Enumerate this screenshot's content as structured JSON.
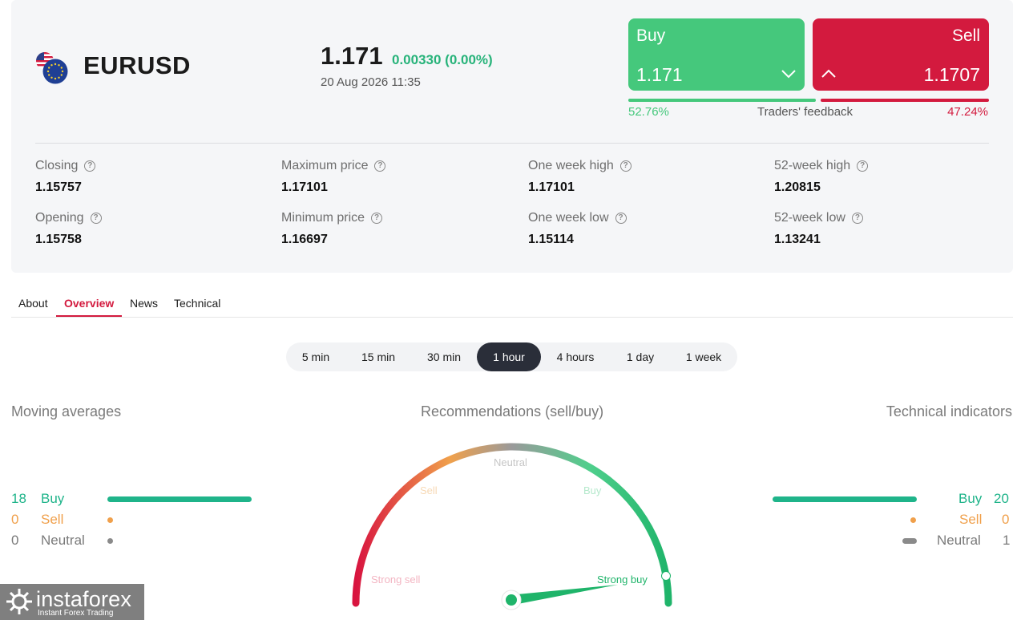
{
  "instrument": {
    "symbol": "EURUSD",
    "price": "1.171",
    "change": "0.00330 (0.00%)",
    "datetime": "20 Aug 2026 11:35",
    "flag_icons": [
      "us-flag-icon",
      "eu-flag-icon"
    ]
  },
  "trade": {
    "buy_label": "Buy",
    "buy_price": "1.171",
    "sell_label": "Sell",
    "sell_price": "1.1707",
    "buy_color": "#45c87c",
    "sell_color": "#d31a3e"
  },
  "feedback": {
    "buy_pct": "52.76%",
    "sell_pct": "47.24%",
    "label": "Traders' feedback",
    "buy_share": 52.76
  },
  "stats": [
    {
      "label": "Closing",
      "value": "1.15757"
    },
    {
      "label": "Maximum price",
      "value": "1.17101"
    },
    {
      "label": "One week high",
      "value": "1.17101"
    },
    {
      "label": "52-week high",
      "value": "1.20815"
    },
    {
      "label": "Opening",
      "value": "1.15758"
    },
    {
      "label": "Minimum price",
      "value": "1.16697"
    },
    {
      "label": "One week low",
      "value": "1.15114"
    },
    {
      "label": "52-week low",
      "value": "1.13241"
    }
  ],
  "tabs": [
    "About",
    "Overview",
    "News",
    "Technical"
  ],
  "active_tab": "Overview",
  "timeframes": [
    "5 min",
    "15 min",
    "30 min",
    "1 hour",
    "4 hours",
    "1 day",
    "1 week"
  ],
  "active_timeframe": "1 hour",
  "moving_averages": {
    "title": "Moving averages",
    "rows": [
      {
        "count": "18",
        "label": "Buy"
      },
      {
        "count": "0",
        "label": "Sell"
      },
      {
        "count": "0",
        "label": "Neutral"
      }
    ]
  },
  "recommendations": {
    "title": "Recommendations (sell/buy)",
    "labels": {
      "strong_sell": "Strong sell",
      "sell": "Sell",
      "neutral": "Neutral",
      "buy": "Buy",
      "strong_buy": "Strong buy"
    },
    "needle": "Strong buy"
  },
  "technical_indicators": {
    "title": "Technical indicators",
    "rows": [
      {
        "count": "20",
        "label": "Buy"
      },
      {
        "count": "0",
        "label": "Sell"
      },
      {
        "count": "1",
        "label": "Neutral"
      }
    ]
  },
  "watermark": {
    "name": "instaforex",
    "tagline": "Instant Forex Trading"
  }
}
